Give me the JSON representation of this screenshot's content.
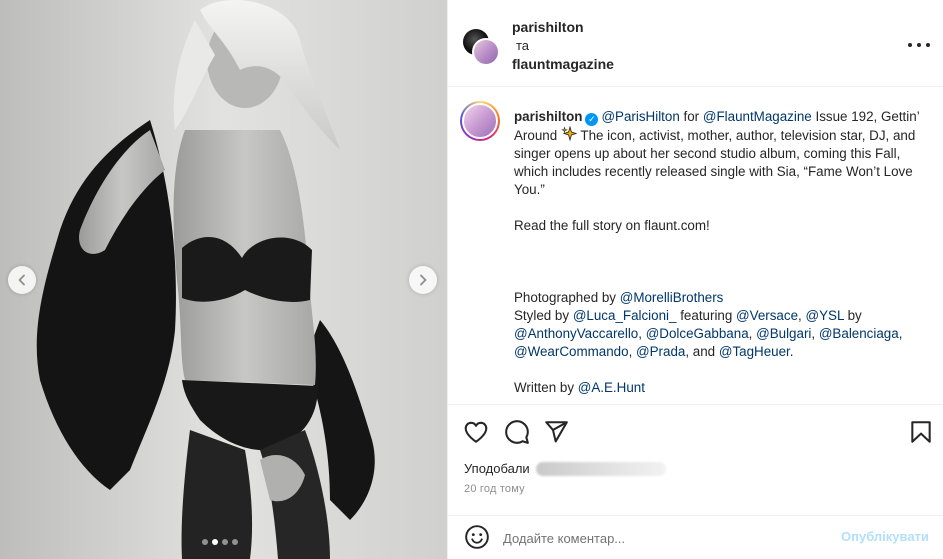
{
  "header": {
    "primary_user": "parishilton",
    "joiner": "та",
    "collab_user": "flauntmagazine",
    "more_icon": "more-horizontal-icon"
  },
  "caption": {
    "username": "parishilton",
    "verified_icon": "verified-badge-icon",
    "paragraph1": {
      "mention1": "@ParisHilton",
      "text1": " for ",
      "mention2": "@FlauntMagazine",
      "text2": " Issue 192, Gettin’ Around ",
      "text3": " The icon, activist, mother, author, television star, DJ, and singer opens up about her second studio album, coming this Fall, which includes recently released single with Sia, “Fame Won’t Love You.”"
    },
    "paragraph2": "Read the full story on flaunt.com!",
    "credits": {
      "photo_label": "Photographed by ",
      "photo_mention": "@MorelliBrothers",
      "styled_label": "Styled by ",
      "styled_m1": "@Luca_Falcioni_",
      "featuring": " featuring ",
      "styled_m2": "@Versace",
      "sep1": ", ",
      "styled_m3": "@YSL",
      "by": " by ",
      "styled_m4": "@AnthonyVaccarello",
      "sep2": ", ",
      "styled_m5": "@DolceGabbana",
      "sep3": ", ",
      "styled_m6": "@Bulgari",
      "sep4": ", ",
      "styled_m7": "@Balenciaga",
      "sep5": ", ",
      "styled_m8": "@WearCommando",
      "sep6": ", ",
      "styled_m9": "@Prada",
      "and": ", and ",
      "styled_m10": "@TagHeuer",
      "period": ".",
      "written_label": "Written by ",
      "written_mention": "@A.E.Hunt"
    }
  },
  "actions": {
    "like_icon": "heart-icon",
    "comment_icon": "comment-icon",
    "share_icon": "send-icon",
    "save_icon": "bookmark-icon",
    "likes_prefix": "Уподобали",
    "timestamp": "20 год тому"
  },
  "comment": {
    "emoji_icon": "emoji-icon",
    "placeholder": "Додайте коментар...",
    "publish_label": "Опублікувати"
  },
  "carousel": {
    "prev_icon": "chevron-left-icon",
    "next_icon": "chevron-right-icon",
    "slide_count": 4,
    "active_index": 1
  },
  "colors": {
    "link": "#00376b",
    "publish_disabled": "#b2dffc",
    "verified": "#0095f6",
    "muted": "#8e8e8e"
  }
}
